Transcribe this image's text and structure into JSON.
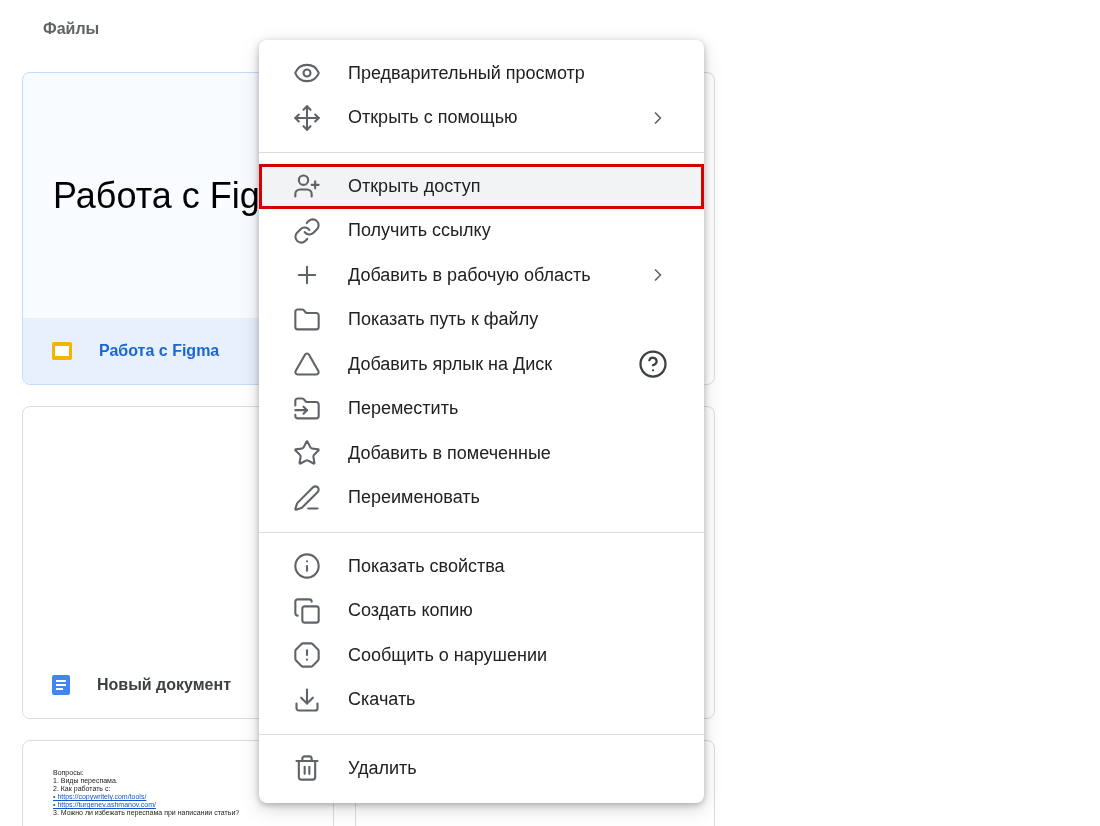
{
  "section_title": "Файлы",
  "cards": [
    {
      "kind": "slides",
      "preview_title": "Работа с Fig",
      "name": "Работа с Figma",
      "selected": true
    },
    {
      "kind": "doc",
      "name": "Новый документ",
      "selected": false
    },
    {
      "kind": "doc-text",
      "preview_lines": [
        "Вопросы:",
        "1.   Виды переспама.",
        "2.   Как работать с:",
        "•   https://copywritely.com/tools/",
        "•   https://turgenev.ashmanov.com/",
        "3.   Можно ли избежать переспама при написании статьи?"
      ],
      "selected": false
    }
  ],
  "context_menu": {
    "groups": [
      [
        {
          "label": "Предварительный просмотр",
          "submenu": false,
          "help": false,
          "selected": false
        },
        {
          "label": "Открыть с помощью",
          "submenu": true,
          "help": false,
          "selected": false
        }
      ],
      [
        {
          "label": "Открыть доступ",
          "submenu": false,
          "help": false,
          "selected": true
        },
        {
          "label": "Получить ссылку",
          "submenu": false,
          "help": false,
          "selected": false
        },
        {
          "label": "Добавить в рабочую область",
          "submenu": true,
          "help": false,
          "selected": false
        },
        {
          "label": "Показать путь к файлу",
          "submenu": false,
          "help": false,
          "selected": false
        },
        {
          "label": "Добавить ярлык на Диск",
          "submenu": false,
          "help": true,
          "selected": false
        },
        {
          "label": "Переместить",
          "submenu": false,
          "help": false,
          "selected": false
        },
        {
          "label": "Добавить в помеченные",
          "submenu": false,
          "help": false,
          "selected": false
        },
        {
          "label": "Переименовать",
          "submenu": false,
          "help": false,
          "selected": false
        }
      ],
      [
        {
          "label": "Показать свойства",
          "submenu": false,
          "help": false,
          "selected": false
        },
        {
          "label": "Создать копию",
          "submenu": false,
          "help": false,
          "selected": false
        },
        {
          "label": "Сообщить о нарушении",
          "submenu": false,
          "help": false,
          "selected": false
        },
        {
          "label": "Скачать",
          "submenu": false,
          "help": false,
          "selected": false
        }
      ],
      [
        {
          "label": "Удалить",
          "submenu": false,
          "help": false,
          "selected": false
        }
      ]
    ]
  }
}
